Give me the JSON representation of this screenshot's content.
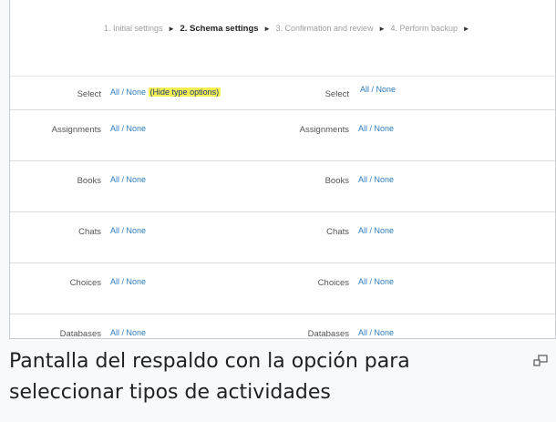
{
  "wizard": {
    "step1": "1. Initial settings",
    "step2": "2. Schema settings",
    "step3": "3. Confirmation and review",
    "step4": "4. Perform backup",
    "arrow": "►"
  },
  "select_row": {
    "label": "Select",
    "all_none": "All / None",
    "hide_types": "(Hide type options)"
  },
  "activity_rows": [
    {
      "label": "Assignments",
      "link": "All / None"
    },
    {
      "label": "Books",
      "link": "All / None"
    },
    {
      "label": "Chats",
      "link": "All / None"
    },
    {
      "label": "Choices",
      "link": "All / None"
    },
    {
      "label": "Databases",
      "link": "All / None"
    }
  ],
  "caption": {
    "text": "Pantalla del respaldo con la opción para seleccionar tipos de actividades",
    "enlarge_icon": "enlarge-icon"
  },
  "colors": {
    "link": "#2b7bbd",
    "highlight": "#f4ef52",
    "caption_text": "#202122"
  }
}
